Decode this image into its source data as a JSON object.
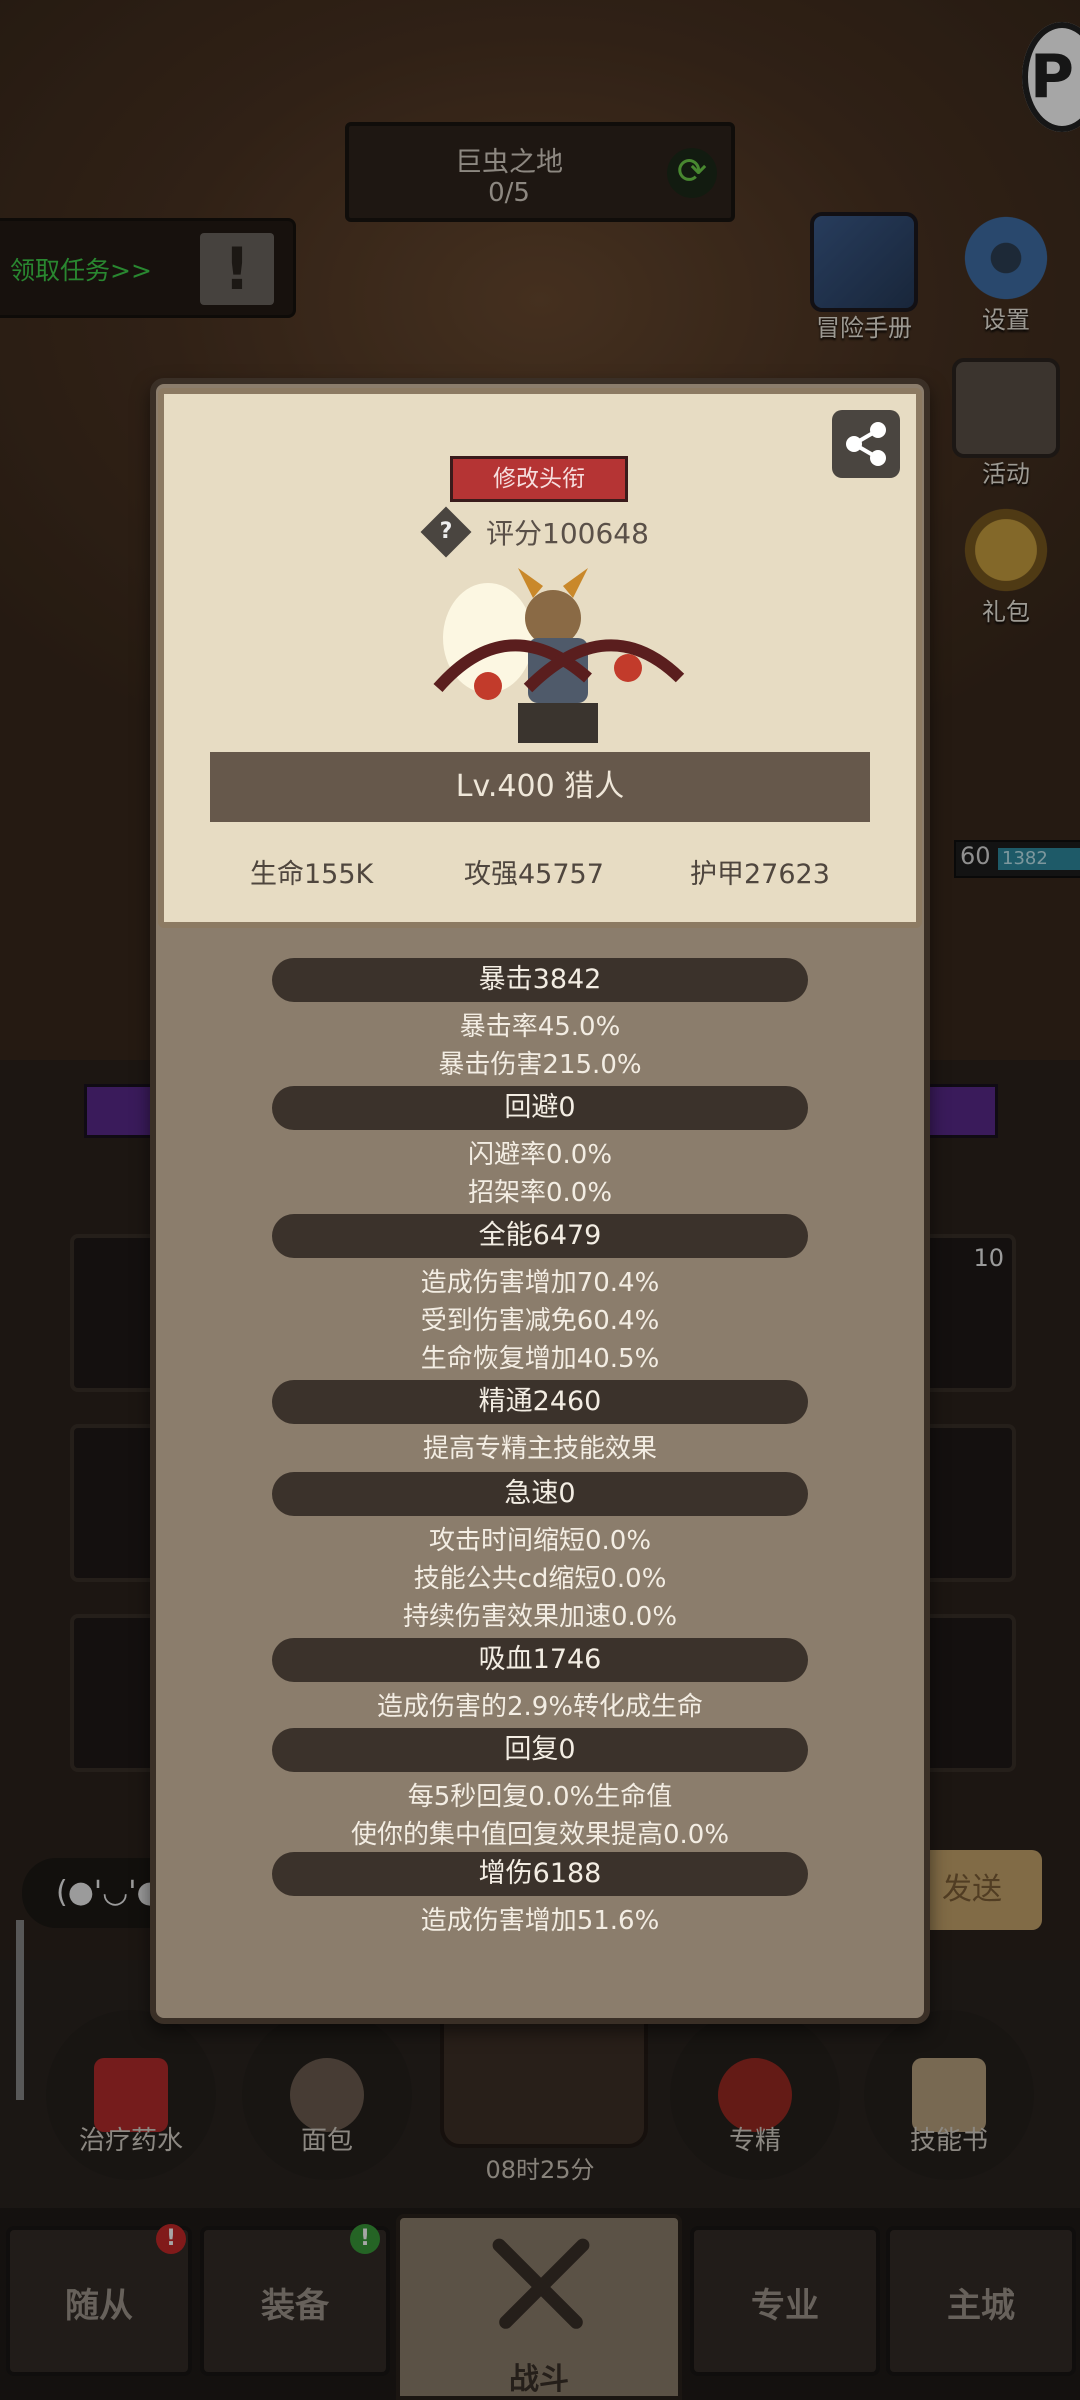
{
  "background": {
    "zone_name": "巨虫之地",
    "zone_progress": "0/5",
    "quest_link": "领取任务>>",
    "side_buttons": [
      {
        "label": "冒险手册",
        "icon": "book-icon"
      },
      {
        "label": "设置",
        "icon": "gear-icon"
      },
      {
        "label": "活动",
        "icon": "board-icon"
      },
      {
        "label": "礼包",
        "icon": "gift-icon"
      }
    ],
    "enemy_level": "60",
    "enemy_hp": "1382",
    "slot_badge": "10",
    "chat_emote": "(●'◡'●",
    "send_label": "发送",
    "quick_items": [
      {
        "label": "治疗药水",
        "icon": "potion-icon"
      },
      {
        "label": "面包",
        "icon": "bread-icon"
      },
      {
        "label": "专精",
        "icon": "spec-icon"
      },
      {
        "label": "技能书",
        "icon": "skillbook-icon"
      }
    ],
    "timer": "08时25分"
  },
  "nav": {
    "items": [
      "随从",
      "装备",
      "战斗",
      "专业",
      "主城"
    ],
    "active": "战斗",
    "alerts": {
      "followers": "!",
      "equipment": "!"
    }
  },
  "profile": {
    "edit_title_label": "修改头衔",
    "score": "评分100648",
    "level_class": "Lv.400 猎人",
    "hp": "生命155K",
    "attack": "攻强45757",
    "armor": "护甲27623"
  },
  "stats": [
    {
      "header": "暴击3842",
      "lines": [
        "暴击率45.0%",
        "暴击伤害215.0%"
      ]
    },
    {
      "header": "回避0",
      "lines": [
        "闪避率0.0%",
        "招架率0.0%"
      ]
    },
    {
      "header": "全能6479",
      "lines": [
        "造成伤害增加70.4%",
        "受到伤害减免60.4%",
        "生命恢复增加40.5%"
      ]
    },
    {
      "header": "精通2460",
      "lines": [
        "提高专精主技能效果"
      ]
    },
    {
      "header": "急速0",
      "lines": [
        "攻击时间缩短0.0%",
        "技能公共cd缩短0.0%",
        "持续伤害效果加速0.0%"
      ]
    },
    {
      "header": "吸血1746",
      "lines": [
        "造成伤害的2.9%转化成生命"
      ]
    },
    {
      "header": "回复0",
      "lines": [
        "每5秒回复0.0%生命值",
        "使你的集中值回复效果提高0.0%"
      ]
    },
    {
      "header": "增伤6188",
      "lines": [
        "造成伤害增加51.6%"
      ]
    }
  ]
}
